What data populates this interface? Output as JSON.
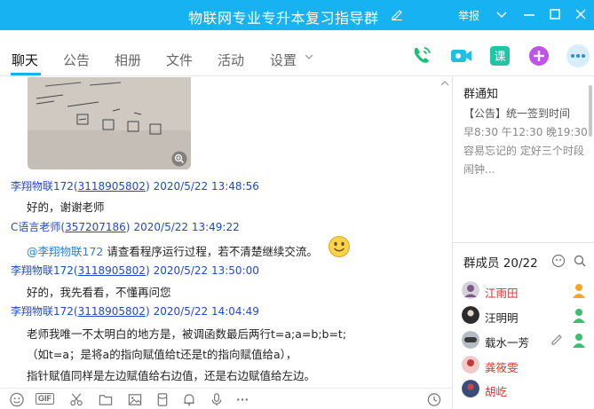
{
  "window": {
    "title": "物联网专业专升本复习指导群",
    "report_label": "举报"
  },
  "tabs": [
    {
      "label": "聊天"
    },
    {
      "label": "公告"
    },
    {
      "label": "相册"
    },
    {
      "label": "文件"
    },
    {
      "label": "活动"
    },
    {
      "label": "设置"
    }
  ],
  "chat": {
    "messages": [
      {
        "sender": "李翔物联172",
        "qq": "3118905802",
        "time": "2020/5/22 13:48:56",
        "body": "好的，谢谢老师"
      },
      {
        "sender": "C语言老师",
        "qq": "357207186",
        "time": "2020/5/22 13:49:22",
        "mention": "@李翔物联172",
        "body": " 请查看程序运行过程，若不清楚继续交流。"
      },
      {
        "sender": "李翔物联172",
        "qq": "3118905802",
        "time": "2020/5/22 13:50:00",
        "body": "好的，我先看看，不懂再问您"
      },
      {
        "sender": "李翔物联172",
        "qq": "3118905802",
        "time": "2020/5/22 14:04:49",
        "lines": [
          "老师我唯一不太明白的地方是，被调函数最后两行t=a;a=b;b=t;",
          "（如t=a；是将a的指向赋值给t还是t的指向赋值给a），",
          "指针赋值同样是左边赋值给右边值，还是右边赋值给左边。"
        ]
      }
    ]
  },
  "input_toolbar": {
    "gif_label": "GIF"
  },
  "notice": {
    "title": "群通知",
    "lines": [
      "【公告】统一签到时间",
      "早8:30 午12:30 晚19:30",
      "容易忘记的 定好三个时段",
      "闹钟..."
    ]
  },
  "members": {
    "title": "群成员 20/22",
    "list": [
      {
        "name": "江雨田",
        "color": "#e0302a"
      },
      {
        "name": "汪明明",
        "color": "#222222"
      },
      {
        "name": "载水一芳",
        "color": "#222222"
      },
      {
        "name": "龚筱雯",
        "color": "#e0302a"
      },
      {
        "name": "胡屹",
        "color": "#e0302a"
      }
    ]
  },
  "colors": {
    "accent": "#16b2f2",
    "link": "#2348c8",
    "mention": "#2f7fd4",
    "owner_red": "#e0302a"
  }
}
